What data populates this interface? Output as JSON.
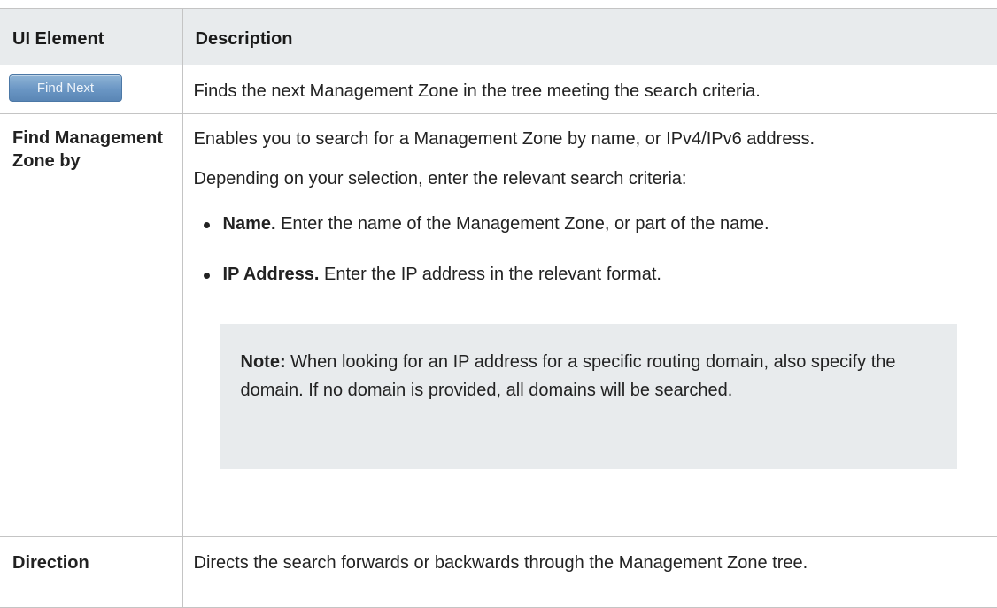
{
  "table": {
    "headers": [
      "UI Element",
      "Description"
    ],
    "rows": [
      {
        "element_button_label": "Find Next",
        "description": "Finds the next Management Zone in the tree meeting the search criteria."
      },
      {
        "element": "Find Management Zone by",
        "description_1": "Enables you to search for a Management Zone by name, or IPv4/IPv6 address.",
        "description_2": "Depending on your selection, enter the relevant search criteria:",
        "options": [
          {
            "label": "Name.",
            "text": "Enter the name of the Management Zone, or part of the name."
          },
          {
            "label": "IP Address.",
            "text": "Enter the IP address in the relevant format."
          }
        ],
        "note_label": "Note:",
        "note_text": "When looking for an IP address for a specific routing domain, also specify the domain. If no domain is provided, all domains will be searched."
      },
      {
        "element": "Direction",
        "description": "Directs the search forwards or backwards through the Management Zone tree."
      }
    ]
  },
  "colors": {
    "header_bg": "#e8ebed",
    "note_bg": "#e8ebed",
    "border": "#c4c4c4",
    "button_blue": "#6a96c4"
  }
}
